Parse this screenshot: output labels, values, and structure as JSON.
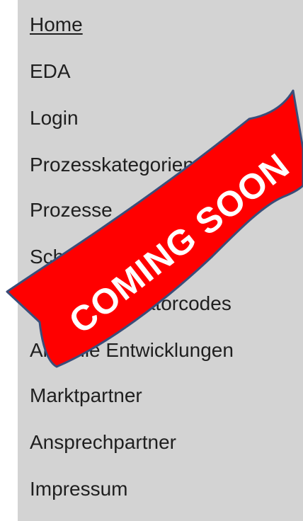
{
  "nav": {
    "items": [
      {
        "label": "Home",
        "active": true
      },
      {
        "label": "EDA"
      },
      {
        "label": "Login"
      },
      {
        "label": "Prozesskategorien"
      },
      {
        "label": "Prozesse"
      },
      {
        "label": "Schema"
      },
      {
        "label": "Pruefidentifikatorcodes"
      },
      {
        "label": "Aktuelle Entwicklungen"
      },
      {
        "label": "Marktpartner"
      },
      {
        "label": "Ansprechpartner"
      },
      {
        "label": "Impressum"
      }
    ]
  },
  "banner": {
    "text": "COMING SOON",
    "color": "#ff0000",
    "border_color": "#3a4e7a"
  }
}
